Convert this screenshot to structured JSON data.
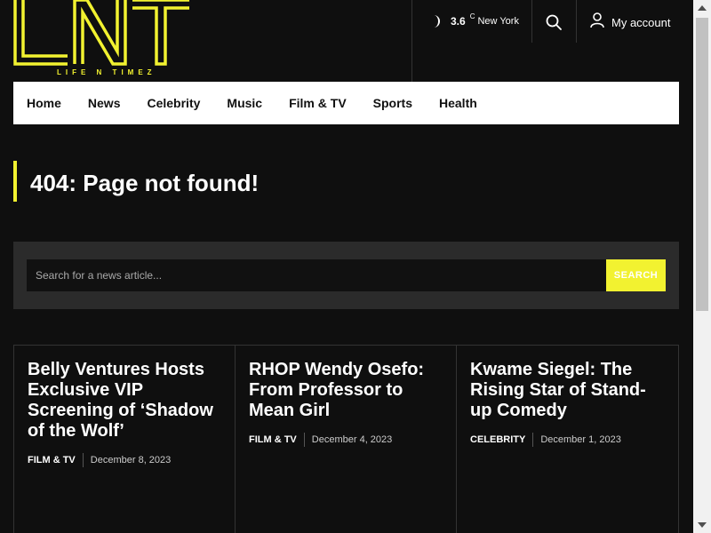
{
  "brand": {
    "name": "LNT",
    "tagline": "LIFE N TIMEZ",
    "accent_color": "#f2f230"
  },
  "weather": {
    "icon": "moon-icon",
    "temperature": "3.6",
    "unit": "C",
    "city": "New York"
  },
  "header": {
    "search_icon": "search-icon",
    "account_icon": "user-icon",
    "account_label": "My account"
  },
  "nav": {
    "items": [
      "Home",
      "News",
      "Celebrity",
      "Music",
      "Film & TV",
      "Sports",
      "Health"
    ]
  },
  "page": {
    "title": "404: Page not found!"
  },
  "search": {
    "placeholder": "Search for a news article...",
    "button_label": "SEARCH"
  },
  "articles": [
    {
      "title": "Belly Ventures Hosts Exclusive VIP Screening of ‘Shadow of the Wolf’",
      "category": "FILM & TV",
      "date": "December 8, 2023"
    },
    {
      "title": "RHOP Wendy Osefo: From Professor to Mean Girl",
      "category": "FILM & TV",
      "date": "December 4, 2023"
    },
    {
      "title": "Kwame Siegel: The Rising Star of Stand-up Comedy",
      "category": "CELEBRITY",
      "date": "December 1, 2023"
    }
  ]
}
